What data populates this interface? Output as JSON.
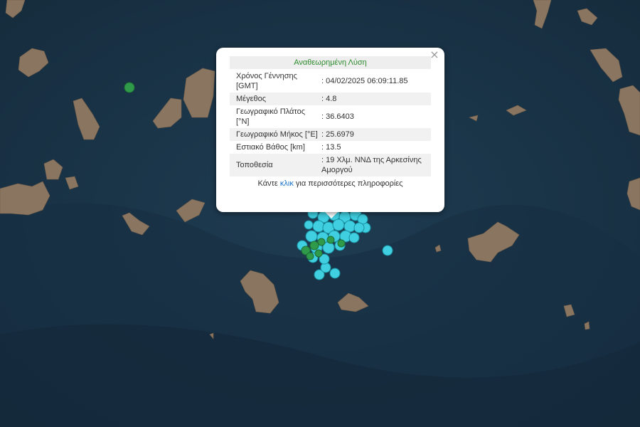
{
  "popup": {
    "title": "Αναθεωρημένη Λύση",
    "close_symbol": "×",
    "rows": [
      {
        "label": "Χρόνος Γέννησης [GMT]",
        "value": ": 04/02/2025 06:09:11.85"
      },
      {
        "label": "Μέγεθος",
        "value": ": 4.8"
      },
      {
        "label": "Γεωγραφικό Πλάτος [°N]",
        "value": ": 36.6403"
      },
      {
        "label": "Γεωγραφικό Μήκος [°E]",
        "value": ": 25.6979"
      },
      {
        "label": "Εστιακό Βάθος [km]",
        "value": ": 13.5"
      },
      {
        "label": "Τοποθεσία",
        "value": ": 19 Χλμ. ΝΝΔ της Αρκεσίνης Αμοργού"
      }
    ],
    "more_prefix": "Κάντε ",
    "more_link": "κλικ",
    "more_suffix": " για περισσότερες πληροφορίες"
  },
  "colors": {
    "sea": "#1b3549",
    "land": "#8a7560",
    "quake_cyan": "#3fcfe0",
    "quake_green": "#2e9a4a"
  }
}
